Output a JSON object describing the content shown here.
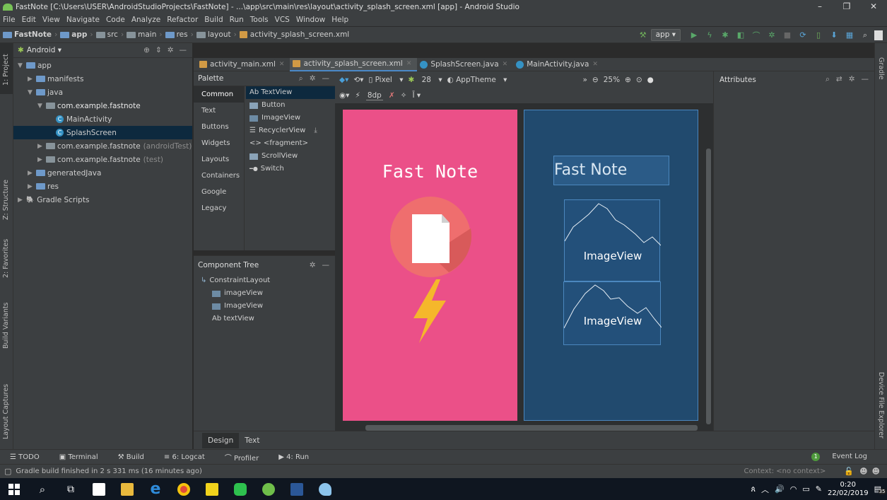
{
  "window": {
    "title": "FastNote [C:\\Users\\USER\\AndroidStudioProjects\\FastNote] - ...\\app\\src\\main\\res\\layout\\activity_splash_screen.xml [app] - Android Studio"
  },
  "menu": [
    "File",
    "Edit",
    "View",
    "Navigate",
    "Code",
    "Analyze",
    "Refactor",
    "Build",
    "Run",
    "Tools",
    "VCS",
    "Window",
    "Help"
  ],
  "breadcrumbs": [
    "FastNote",
    "app",
    "src",
    "main",
    "res",
    "layout",
    "activity_splash_screen.xml"
  ],
  "run_config": "app",
  "left_tabs": [
    "1: Project",
    "Z: Structure",
    "2: Favorites",
    "Build Variants",
    "Layout Captures"
  ],
  "right_tabs": [
    "Gradle",
    "Device File Explorer"
  ],
  "project": {
    "view": "Android",
    "tree": [
      {
        "label": "app",
        "depth": 0,
        "arrow": "▼",
        "icon": "folder"
      },
      {
        "label": "manifests",
        "depth": 1,
        "arrow": "▶",
        "icon": "folder"
      },
      {
        "label": "java",
        "depth": 1,
        "arrow": "▼",
        "icon": "folder"
      },
      {
        "label": "com.example.fastnote",
        "depth": 2,
        "arrow": "▼",
        "icon": "package"
      },
      {
        "label": "MainActivity",
        "depth": 3,
        "arrow": "",
        "icon": "class"
      },
      {
        "label": "SplashScreen",
        "depth": 3,
        "arrow": "",
        "icon": "class",
        "selected": true
      },
      {
        "label": "com.example.fastnote",
        "suffix": "(androidTest)",
        "depth": 2,
        "arrow": "▶",
        "icon": "package"
      },
      {
        "label": "com.example.fastnote",
        "suffix": "(test)",
        "depth": 2,
        "arrow": "▶",
        "icon": "package"
      },
      {
        "label": "generatedJava",
        "depth": 1,
        "arrow": "▶",
        "icon": "folder"
      },
      {
        "label": "res",
        "depth": 1,
        "arrow": "▶",
        "icon": "folder"
      },
      {
        "label": "Gradle Scripts",
        "depth": 0,
        "arrow": "▶",
        "icon": "gradle"
      }
    ]
  },
  "editor_tabs": [
    {
      "label": "activity_main.xml",
      "icon": "xml"
    },
    {
      "label": "activity_splash_screen.xml",
      "icon": "xml",
      "active": true
    },
    {
      "label": "SplashScreen.java",
      "icon": "java"
    },
    {
      "label": "MainActivity.java",
      "icon": "java"
    }
  ],
  "palette": {
    "title": "Palette",
    "categories": [
      "Common",
      "Text",
      "Buttons",
      "Widgets",
      "Layouts",
      "Containers",
      "Google",
      "Legacy"
    ],
    "items": [
      "Ab TextView",
      "Button",
      "ImageView",
      "RecyclerView",
      "<> <fragment>",
      "ScrollView",
      "Switch"
    ]
  },
  "component_tree": {
    "title": "Component Tree",
    "items": [
      "ConstraintLayout",
      "imageView",
      "ImageView",
      "Ab textView"
    ]
  },
  "design_toolbar": {
    "device": "Pixel",
    "api": "28",
    "theme": "AppTheme",
    "zoom": "25%",
    "margin": "8dp"
  },
  "attributes": {
    "title": "Attributes"
  },
  "preview": {
    "title_text": "Fast Note",
    "bg_color": "#eb5088",
    "blueprint_label": "Fast Note",
    "imageview_label": "ImageView"
  },
  "design_tabs": [
    "Design",
    "Text"
  ],
  "tool_windows": [
    "TODO",
    "Terminal",
    "Build",
    "6: Logcat",
    "Profiler",
    "4: Run"
  ],
  "event_log": {
    "count": "1",
    "label": "Event Log"
  },
  "status": {
    "message": "Gradle build finished in 2 s 331 ms (16 minutes ago)",
    "context": "Context: <no context>"
  },
  "clock": {
    "time": "0:20",
    "date": "22/02/2019",
    "notifications": "35"
  }
}
